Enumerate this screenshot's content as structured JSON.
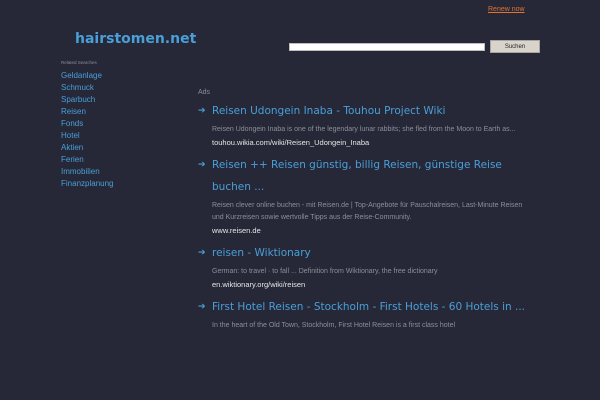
{
  "header": {
    "renew_label": "Renew now",
    "logo_text": "hairstomen.net",
    "search": {
      "value": "",
      "placeholder": "",
      "button_label": "Suchen"
    }
  },
  "sidebar": {
    "heading": "Related Searches",
    "items": [
      {
        "label": "Geldanlage"
      },
      {
        "label": "Schmuck"
      },
      {
        "label": "Sparbuch"
      },
      {
        "label": "Reisen"
      },
      {
        "label": "Fonds"
      },
      {
        "label": "Hotel"
      },
      {
        "label": "Aktien"
      },
      {
        "label": "Ferien"
      },
      {
        "label": "Immobilien"
      },
      {
        "label": "Finanzplanung"
      }
    ]
  },
  "main": {
    "ads_label": "Ads",
    "results": [
      {
        "title": "Reisen Udongein Inaba - Touhou Project Wiki",
        "description": "Reisen Udongein Inaba is one of the legendary lunar rabbits; she fled from the Moon to Earth as...",
        "url": "touhou.wikia.com/wiki/Reisen_Udongein_Inaba"
      },
      {
        "title": "Reisen ++ Reisen günstig, billig Reisen, günstige Reise buchen ...",
        "description": "Reisen clever online buchen - mit Reisen.de | Top-Angebote für Pauschalreisen, Last-Minute Reisen und Kurzreisen sowie wertvolle Tipps aus der Reise-Community.",
        "url": "www.reisen.de"
      },
      {
        "title": "reisen - Wiktionary",
        "description": "German: to travel · to fall ... Definition from Wiktionary, the free dictionary",
        "url": "en.wiktionary.org/wiki/reisen"
      },
      {
        "title": "First Hotel Reisen - Stockholm - First Hotels - 60 Hotels in ...",
        "description": "In the heart of the Old Town, Stockholm, First Hotel Reisen is a first class hotel",
        "url": ""
      }
    ]
  },
  "icons": {
    "result_arrow": "arrow-right-icon"
  },
  "colors": {
    "background": "#262837",
    "link": "#4a9fd8",
    "renew": "#e0732f",
    "muted_text": "#8d8e99",
    "url_text": "#e6e6e6"
  }
}
